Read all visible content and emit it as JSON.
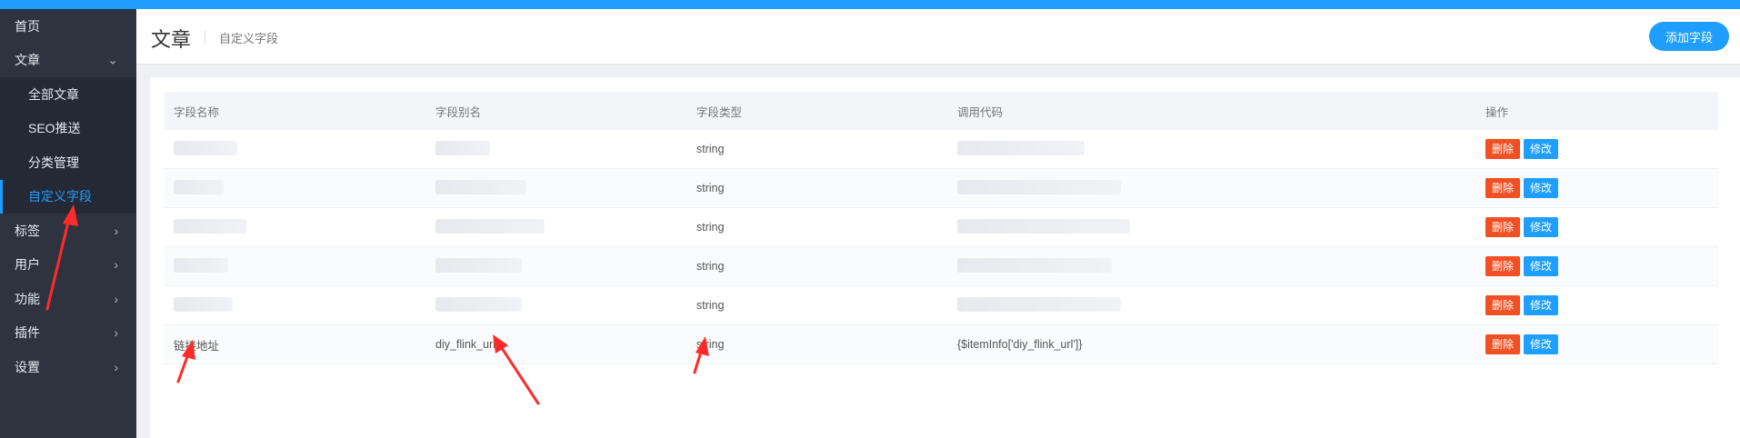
{
  "sidebar": {
    "items": [
      {
        "label": "首页"
      },
      {
        "label": "文章",
        "expanded": true
      },
      {
        "label": "标签"
      },
      {
        "label": "用户"
      },
      {
        "label": "功能"
      },
      {
        "label": "插件"
      },
      {
        "label": "设置"
      }
    ],
    "subitems": [
      {
        "label": "全部文章"
      },
      {
        "label": "SEO推送"
      },
      {
        "label": "分类管理"
      },
      {
        "label": "自定义字段",
        "active": true
      }
    ]
  },
  "header": {
    "title": "文章",
    "subtitle": "自定义字段",
    "add_button": "添加字段"
  },
  "table": {
    "columns": [
      "字段名称",
      "字段别名",
      "字段类型",
      "调用代码",
      "操作"
    ],
    "rows": [
      {
        "name": "",
        "alias": "",
        "type": "string",
        "code": "",
        "blurred": true
      },
      {
        "name": "",
        "alias": "",
        "type": "string",
        "code": "",
        "blurred": true
      },
      {
        "name": "",
        "alias": "",
        "type": "string",
        "code": "",
        "blurred": true
      },
      {
        "name": "",
        "alias": "",
        "type": "string",
        "code": "",
        "blurred": true
      },
      {
        "name": "",
        "alias": "",
        "type": "string",
        "code": "",
        "blurred": true
      },
      {
        "name": "链接地址",
        "alias": "diy_flink_url",
        "type": "string",
        "code": "{$itemInfo['diy_flink_url']}",
        "blurred": false
      }
    ],
    "delete_label": "删除",
    "edit_label": "修改"
  },
  "colors": {
    "accent": "#1e9fff",
    "danger": "#f05023",
    "sidebar": "#2f3340",
    "annotation": "#ff2b2b"
  }
}
